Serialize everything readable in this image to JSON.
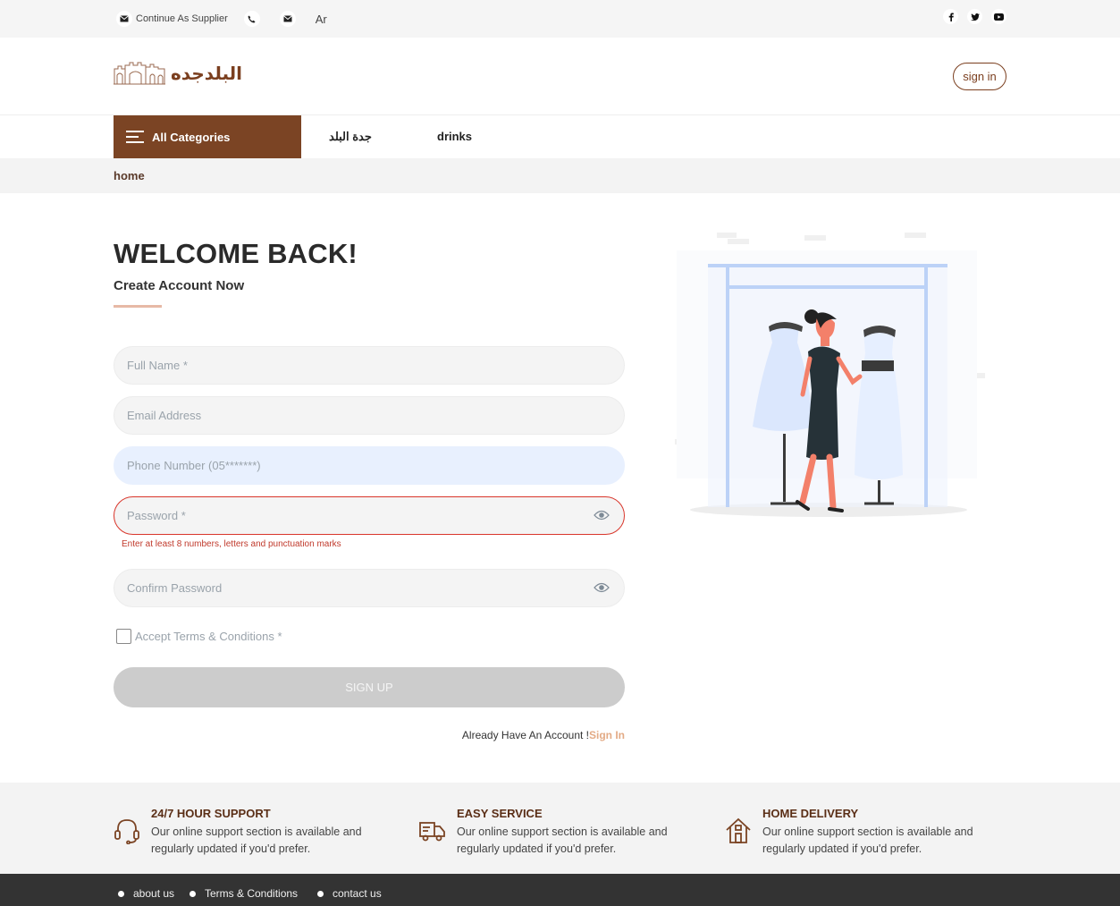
{
  "topbar": {
    "supplier_label": "Continue As Supplier",
    "lang_label": "Ar",
    "icons": [
      "mail-icon",
      "phone-icon",
      "mail-icon"
    ],
    "social": [
      "facebook-icon",
      "twitter-icon",
      "youtube-icon"
    ]
  },
  "header": {
    "logo_text": "البلدجده",
    "signin_label": "sign in"
  },
  "nav": {
    "all_categories": "All Categories",
    "links": [
      "جدة البلد",
      "drinks"
    ]
  },
  "breadcrumb": {
    "current": "home"
  },
  "form": {
    "title": "WELCOME BACK!",
    "subtitle": "Create Account Now",
    "full_name_placeholder": "Full Name *",
    "email_placeholder": "Email Address",
    "phone_placeholder": "Phone Number (05*******)",
    "password_placeholder": "Password *",
    "password_error": "Enter at least 8 numbers, letters and punctuation marks",
    "confirm_placeholder": "Confirm Password",
    "terms_label": "Accept Terms & Conditions *",
    "signup_label": "SIGN UP",
    "already_text": "Already Have An Account !",
    "signin_link": "Sign In"
  },
  "features": [
    {
      "title": "24/7 HOUR SUPPORT",
      "text": "Our online support section is available and regularly updated if you'd prefer.",
      "icon": "headset-icon"
    },
    {
      "title": "EASY SERVICE",
      "text": "Our online support section is available and regularly updated if you'd prefer.",
      "icon": "truck-icon"
    },
    {
      "title": "HOME DELIVERY",
      "text": "Our online support section is available and regularly updated if you'd prefer.",
      "icon": "house-icon"
    }
  ],
  "footer": {
    "links": [
      "about us",
      "Terms & Conditions",
      "contact us"
    ]
  },
  "colors": {
    "brand": "#7b4424",
    "accent": "#e3ab86",
    "error": "#d9362b",
    "footer": "#333333"
  }
}
